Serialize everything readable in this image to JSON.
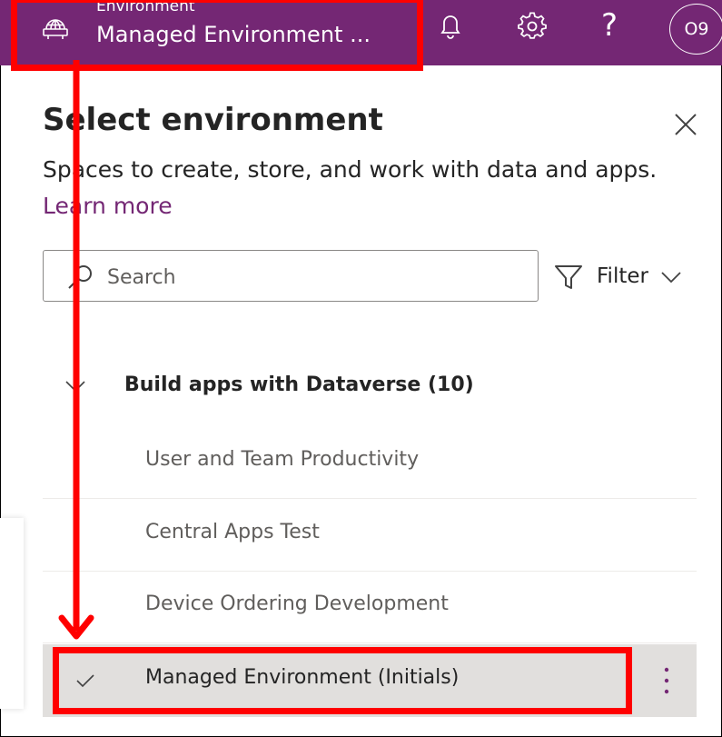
{
  "topbar": {
    "env_label": "Environment",
    "env_name": "Managed Environment ...",
    "help_glyph": "?",
    "avatar_initials": "O9",
    "brand_color": "#742774",
    "icons": [
      "globe-icon",
      "bell-icon",
      "gear-icon",
      "help-icon"
    ]
  },
  "panel": {
    "title": "Select environment",
    "subtitle": "Spaces to create, store, and work with data and apps.",
    "learn_more": "Learn more",
    "search_placeholder": "Search",
    "filter_label": "Filter",
    "group": {
      "title": "Build apps with Dataverse (10)",
      "items": [
        {
          "name": "User and Team Productivity",
          "selected": false
        },
        {
          "name": "Central Apps Test",
          "selected": false
        },
        {
          "name": "Device Ordering Development",
          "selected": false
        },
        {
          "name": "Managed Environment (Initials)",
          "selected": true
        }
      ]
    }
  },
  "annotation_color": "#ff0000"
}
